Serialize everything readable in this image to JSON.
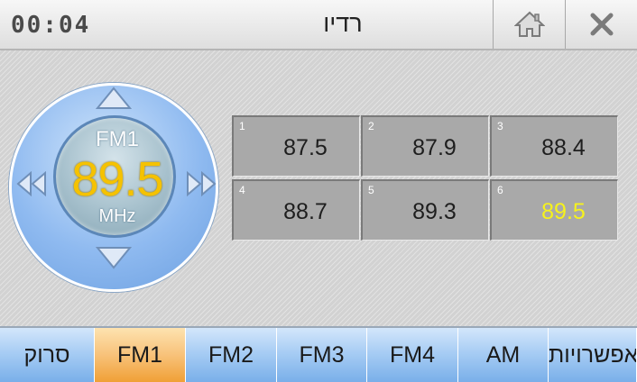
{
  "titlebar": {
    "clock": "00:04",
    "title": "רדיו",
    "home_icon": "home-icon",
    "close_icon": "close-icon"
  },
  "dial": {
    "band": "FM1",
    "frequency": "89.5",
    "unit": "MHz",
    "frequency_color": "#f5c200"
  },
  "presets": [
    {
      "number": "1",
      "frequency": "87.5"
    },
    {
      "number": "2",
      "frequency": "87.9"
    },
    {
      "number": "3",
      "frequency": "88.4"
    },
    {
      "number": "4",
      "frequency": "88.7"
    },
    {
      "number": "5",
      "frequency": "89.3"
    },
    {
      "number": "6",
      "frequency": "89.5",
      "active": true
    }
  ],
  "tabs": [
    {
      "label": "סרוק"
    },
    {
      "label": "FM1",
      "selected": true
    },
    {
      "label": "FM2"
    },
    {
      "label": "FM3"
    },
    {
      "label": "FM4"
    },
    {
      "label": "AM"
    },
    {
      "label": "אפשרויות"
    }
  ],
  "colors": {
    "tab_blue": "#a8cdf4",
    "tab_selected": "#f8c27a",
    "active_preset_text": "#f6f21c"
  }
}
